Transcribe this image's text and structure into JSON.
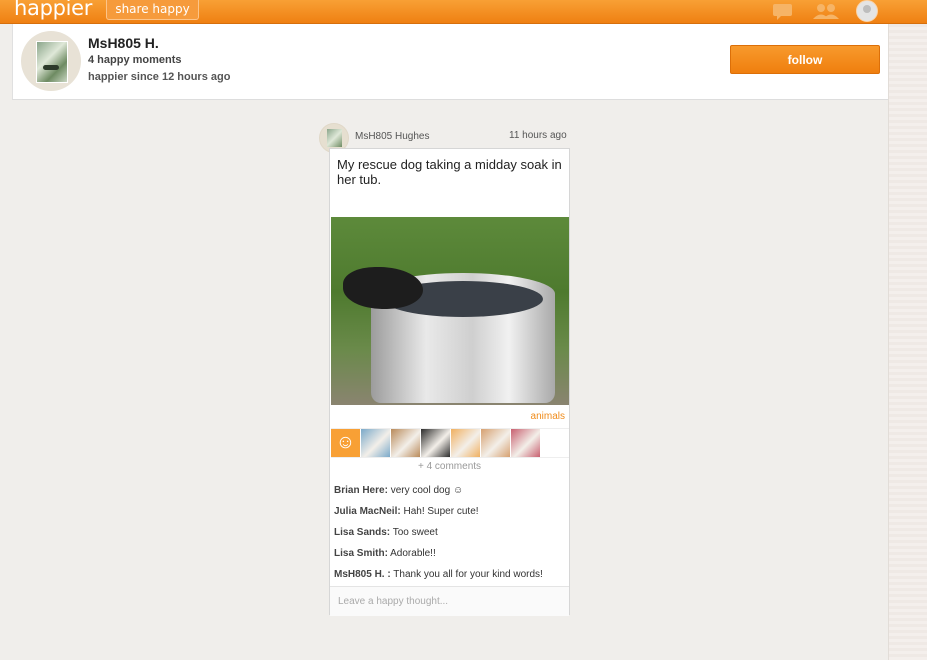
{
  "topbar": {
    "logo": "happier",
    "share_label": "share happy",
    "icons": [
      "chat-icon",
      "people-icon",
      "user-avatar-icon"
    ]
  },
  "profile": {
    "name": "MsH805 H.",
    "moments": "4 happy moments",
    "since": "happier since 12 hours ago",
    "follow_label": "follow"
  },
  "post": {
    "author": "MsH805 Hughes",
    "time": "11 hours ago",
    "caption": "My rescue dog taking a midday soak in her tub.",
    "tag": "animals",
    "react_icon": "smiley-icon",
    "react_glyph": "☺",
    "reactor_colors": [
      "#7aa9c9",
      "#b98a5a",
      "#2c2c2c",
      "#f0b060",
      "#d6a070",
      "#c86070"
    ],
    "more_comments": "+ 4 comments",
    "comments": [
      {
        "author": "Brian Here:",
        "text": "very cool dog ☺"
      },
      {
        "author": "Julia MacNeil:",
        "text": "Hah! Super cute!"
      },
      {
        "author": "Lisa Sands:",
        "text": "Too sweet"
      },
      {
        "author": "Lisa Smith:",
        "text": "Adorable!!"
      },
      {
        "author": "MsH805 H. :",
        "text": "Thank you all for your kind words!"
      }
    ],
    "input_placeholder": "Leave a happy thought..."
  },
  "colors": {
    "brand_orange": "#ef8012",
    "tag_orange": "#f08c1b"
  }
}
